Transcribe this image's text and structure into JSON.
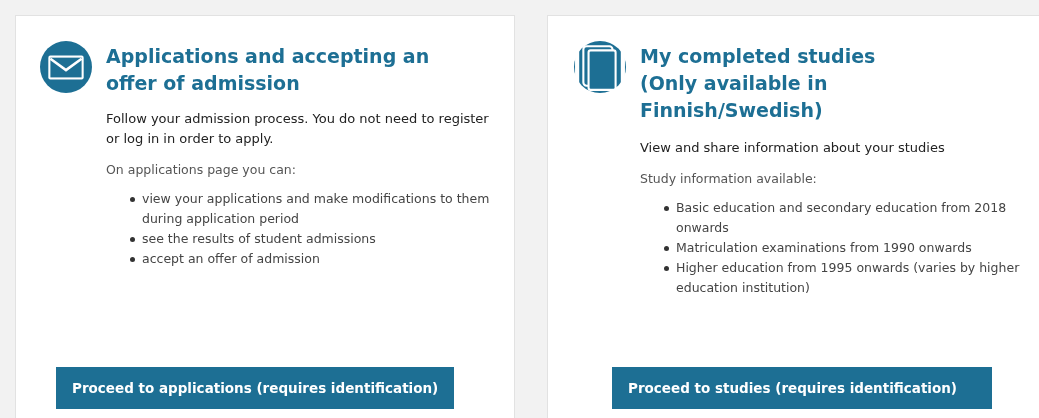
{
  "cards": [
    {
      "kind": "envelope",
      "title": "Applications and accepting an offer of admission",
      "intro": "Follow your admission process. You do not need to register or log in in order to apply.",
      "list_heading": "On applications page you can:",
      "items": [
        "view your applications and make modifications to them during application period",
        "see the results of student admissions",
        "accept an offer of admission"
      ],
      "button": "Proceed to applications (requires identification)"
    },
    {
      "kind": "book",
      "title": "My completed studies (Only available in Finnish/Swedish)",
      "intro": "View and share information about your studies",
      "list_heading": "Study information available:",
      "items": [
        "Basic education and secondary education from 2018 onwards",
        "Matriculation examinations from 1990 onwards",
        "Higher education from 1995 onwards (varies by higher education institution)"
      ],
      "button": "Proceed to studies (requires identification)"
    }
  ]
}
